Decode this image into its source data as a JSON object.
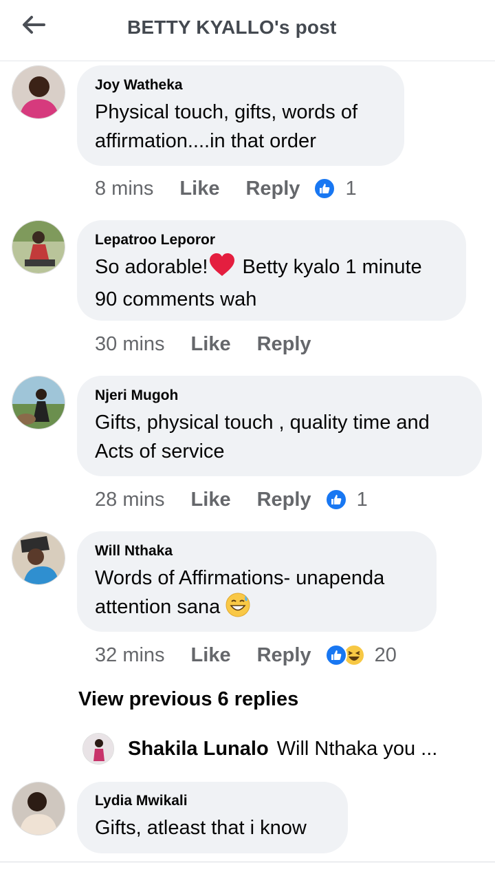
{
  "header": {
    "title": "BETTY KYALLO's post",
    "back_icon": "arrow-left-icon"
  },
  "comments": [
    {
      "author": "Joy Watheka",
      "text_1": "Physical touch, gifts, words of",
      "text_2": "affirmation....in that order",
      "time": "8 mins",
      "like": "Like",
      "reply": "Reply",
      "reaction_count": "1"
    },
    {
      "author": "Lepatroo Leporor",
      "text_1a": "So adorable!",
      "text_1b": " Betty kyalo 1 minute",
      "text_2": "90 comments wah",
      "time": "30 mins",
      "like": "Like",
      "reply": "Reply"
    },
    {
      "author": "Njeri Mugoh",
      "text_1": "Gifts, physical touch , quality time and",
      "text_2": "Acts of service",
      "time": "28 mins",
      "like": "Like",
      "reply": "Reply",
      "reaction_count": "1"
    },
    {
      "author": "Will Nthaka",
      "text_1": "Words of Affirmations- unapenda",
      "text_2": "attention sana ",
      "time": "32 mins",
      "like": "Like",
      "reply": "Reply",
      "reaction_count": "20"
    },
    {
      "author": "Lydia Mwikali",
      "text_1": "Gifts, atleast that i know"
    }
  ],
  "view_previous": "View previous 6 replies",
  "nested_reply": {
    "author": "Shakila Lunalo",
    "text": "Will Nthaka you ..."
  },
  "colors": {
    "like_blue": "#1877f2",
    "bubble": "#f0f2f5",
    "meta_gray": "#65676b"
  }
}
